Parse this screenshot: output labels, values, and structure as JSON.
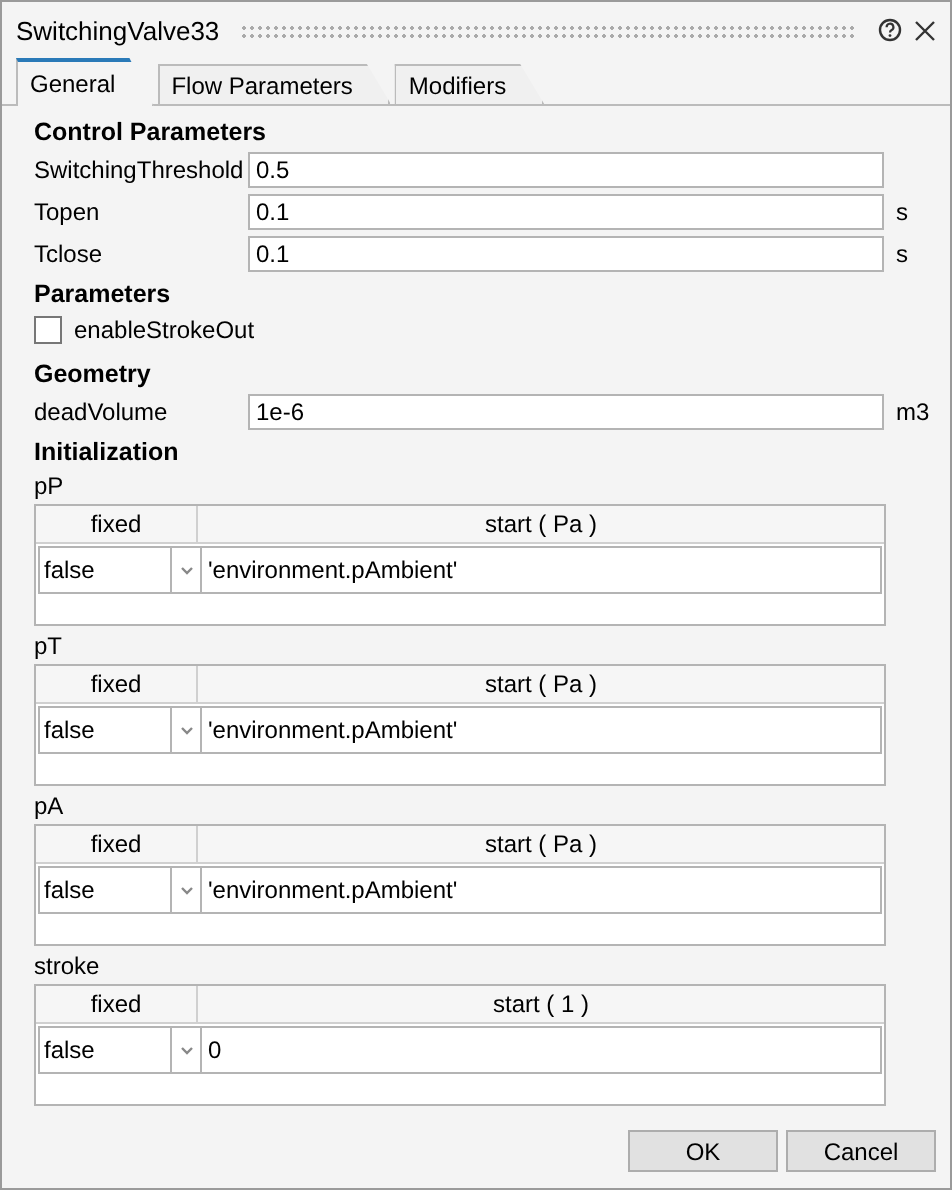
{
  "window": {
    "title": "SwitchingValve33"
  },
  "tabs": [
    {
      "label": "General",
      "selected": true
    },
    {
      "label": "Flow Parameters",
      "selected": false
    },
    {
      "label": "Modifiers",
      "selected": false
    }
  ],
  "sections": [
    {
      "heading": "Control Parameters",
      "items": [
        {
          "kind": "field",
          "label": "SwitchingThreshold",
          "value": "0.5"
        },
        {
          "kind": "field",
          "label": "Topen",
          "value": "0.1",
          "unit": "s"
        },
        {
          "kind": "field",
          "label": "Tclose",
          "value": "0.1",
          "unit": "s"
        }
      ]
    },
    {
      "heading": "Parameters",
      "items": [
        {
          "kind": "checkbox",
          "label": "enableStrokeOut",
          "checked": false
        }
      ]
    },
    {
      "heading": "Geometry",
      "items": [
        {
          "kind": "field",
          "label": "deadVolume",
          "value": "1e-6",
          "unit": "m3"
        }
      ]
    },
    {
      "heading": "Initialization",
      "items": [
        {
          "kind": "table",
          "label": "pP",
          "columns": [
            "fixed",
            "start ( Pa )"
          ],
          "fixed": "false",
          "start": "'environment.pAmbient'"
        },
        {
          "kind": "table",
          "label": "pT",
          "columns": [
            "fixed",
            "start ( Pa )"
          ],
          "fixed": "false",
          "start": "'environment.pAmbient'"
        },
        {
          "kind": "table",
          "label": "pA",
          "columns": [
            "fixed",
            "start ( Pa )"
          ],
          "fixed": "false",
          "start": "'environment.pAmbient'"
        },
        {
          "kind": "table",
          "label": "stroke",
          "columns": [
            "fixed",
            "start ( 1 )"
          ],
          "fixed": "false",
          "start": "0"
        }
      ]
    }
  ],
  "buttons": [
    "OK",
    "Cancel"
  ]
}
